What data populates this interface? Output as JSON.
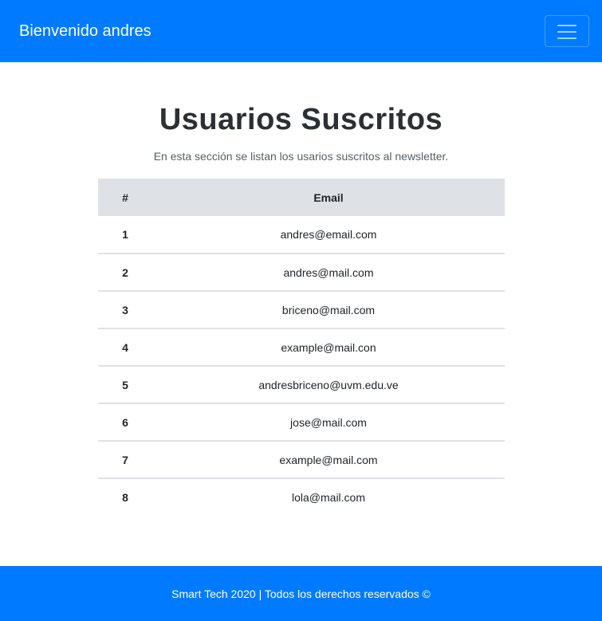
{
  "navbar": {
    "brand": "Bienvenido andres",
    "toggler_icon": "hamburger-menu-icon",
    "background_color": "#007bff"
  },
  "main": {
    "title": "Usuarios Suscritos",
    "subtitle": "En esta sección se listan los usarios suscritos al newsletter.",
    "table": {
      "headers": [
        "#",
        "Email"
      ],
      "rows": [
        {
          "num": "1",
          "email": "andres@email.com"
        },
        {
          "num": "2",
          "email": "andres@mail.com"
        },
        {
          "num": "3",
          "email": "briceno@mail.com"
        },
        {
          "num": "4",
          "email": "example@mail.con"
        },
        {
          "num": "5",
          "email": "andresbriceno@uvm.edu.ve"
        },
        {
          "num": "6",
          "email": "jose@mail.com"
        },
        {
          "num": "7",
          "email": "example@mail.com"
        },
        {
          "num": "8",
          "email": "lola@mail.com"
        }
      ]
    }
  },
  "footer": {
    "text": "Smart Tech 2020 | Todos los derechos reservados ©"
  }
}
